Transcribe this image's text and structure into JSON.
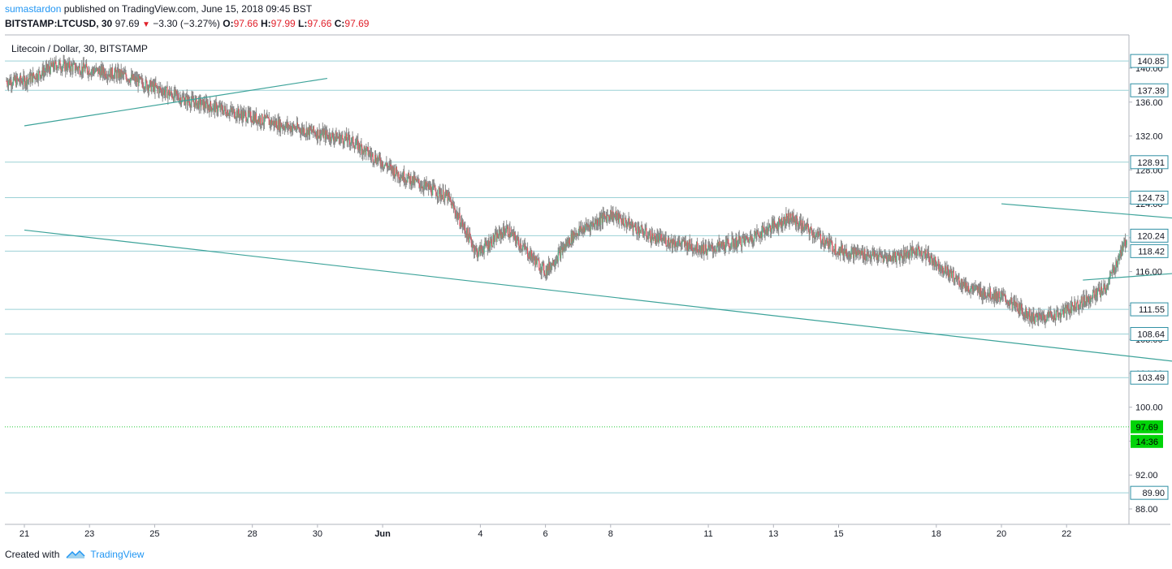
{
  "header": {
    "user": "sumastardon",
    "published": "published on TradingView.com, June 15, 2018 09:45 BST",
    "symbol": "BITSTAMP:LTCUSD, 30",
    "last": "97.69",
    "change_arrow": "▼",
    "change": "−3.30 (−3.27%)",
    "o_label": "O:",
    "o_value": "97.66",
    "h_label": "H:",
    "h_value": "97.99",
    "l_label": "L:",
    "l_value": "97.66",
    "c_label": "C:",
    "c_value": "97.69"
  },
  "footer": {
    "created_with": "Created with",
    "brand": "TradingView"
  },
  "colors": {
    "up": "#53b987",
    "down": "#eb4d5c",
    "line": "#3da39a",
    "hline": "#9bd1d6",
    "tag_bg": "#2e8fa3",
    "price_tag": "#00d408"
  },
  "chart_data": {
    "type": "candlestick",
    "title": "Litecoin / Dollar, 30, BITSTAMP",
    "xlabel": "",
    "ylabel": "",
    "ylim": [
      86.5,
      143.5
    ],
    "y_ticks": [
      "140.00",
      "136.00",
      "132.00",
      "128.00",
      "124.00",
      "120.00",
      "116.00",
      "112.00",
      "108.00",
      "104.00",
      "100.00",
      "96.00",
      "92.00",
      "88.00"
    ],
    "x_ticks": [
      "21",
      "23",
      "25",
      "28",
      "30",
      "Jun",
      "4",
      "6",
      "8",
      "11",
      "13",
      "15",
      "18",
      "20",
      "22"
    ],
    "levels": [
      "140.85",
      "137.39",
      "128.91",
      "124.73",
      "120.24",
      "118.42",
      "111.55",
      "108.64",
      "103.49",
      "89.90"
    ],
    "last_price": {
      "value": "97.69",
      "countdown": "14:36"
    },
    "path": [
      [
        0,
        138.5
      ],
      [
        1,
        140.4
      ],
      [
        3,
        139.2
      ],
      [
        5,
        136.2
      ],
      [
        8,
        133.2
      ],
      [
        10,
        131.5
      ],
      [
        11.5,
        127.5
      ],
      [
        13,
        124.8
      ],
      [
        13.9,
        118.2
      ],
      [
        14.8,
        121.0
      ],
      [
        16,
        116.0
      ],
      [
        16.9,
        120.5
      ],
      [
        18,
        122.8
      ],
      [
        19.3,
        120.0
      ],
      [
        21,
        118.6
      ],
      [
        22.2,
        119.8
      ],
      [
        23.5,
        122.4
      ],
      [
        25,
        118.5
      ],
      [
        26.5,
        117.6
      ],
      [
        27.5,
        118.5
      ],
      [
        29,
        114.0
      ],
      [
        30,
        113.0
      ],
      [
        31,
        110.5
      ],
      [
        31.8,
        111.0
      ],
      [
        33.2,
        114.0
      ],
      [
        34,
        121.2
      ],
      [
        35,
        122.5
      ],
      [
        36,
        121.0
      ],
      [
        37,
        119.5
      ],
      [
        38,
        116.0
      ],
      [
        39.5,
        118.5
      ],
      [
        40.5,
        120.5
      ],
      [
        41.5,
        118.5
      ],
      [
        43,
        117.3
      ],
      [
        44,
        118.3
      ],
      [
        45,
        119.0
      ],
      [
        46.5,
        119.8
      ],
      [
        47.4,
        123.5
      ],
      [
        48.5,
        122.5
      ],
      [
        50,
        123.0
      ],
      [
        51.3,
        123.0
      ],
      [
        51.8,
        127.4
      ],
      [
        52.5,
        127.2
      ],
      [
        53.2,
        126.4
      ],
      [
        54,
        126.0
      ],
      [
        55,
        123.5
      ],
      [
        56.5,
        120.0
      ],
      [
        57.5,
        119.5
      ],
      [
        58.5,
        117.0
      ],
      [
        59.5,
        116.4
      ],
      [
        60.5,
        121.8
      ],
      [
        61.5,
        122.8
      ],
      [
        63,
        122.2
      ],
      [
        64,
        122.6
      ],
      [
        64.8,
        120.0
      ],
      [
        65.5,
        123.5
      ],
      [
        66.5,
        122.5
      ],
      [
        68,
        122.0
      ],
      [
        70,
        121.0
      ],
      [
        71,
        120.0
      ],
      [
        72.2,
        120.4
      ],
      [
        73.5,
        120.8
      ],
      [
        75.5,
        118.8
      ],
      [
        76.3,
        115.7
      ],
      [
        77.6,
        113.0
      ],
      [
        78.4,
        106.8
      ],
      [
        79.5,
        108.0
      ],
      [
        80.5,
        106.0
      ],
      [
        81.5,
        107.0
      ],
      [
        83,
        107.5
      ],
      [
        84.5,
        106.5
      ],
      [
        85.2,
        102.5
      ],
      [
        86.1,
        98.5
      ],
      [
        87,
        99.0
      ],
      [
        87.7,
        98.4
      ],
      [
        88.4,
        95.0
      ],
      [
        89.2,
        90.0
      ],
      [
        90,
        92.5
      ],
      [
        91,
        94.8
      ],
      [
        92,
        96.0
      ],
      [
        92.7,
        96.6
      ],
      [
        93.5,
        97.6
      ],
      [
        94.1,
        102.0
      ],
      [
        95.2,
        100.5
      ],
      [
        95.7,
        97.7
      ]
    ],
    "trendlines": [
      [
        [
          0,
          133.2
        ],
        [
          9.3,
          138.8
        ]
      ],
      [
        [
          0,
          120.9
        ],
        [
          78.4,
          86.5
        ]
      ],
      [
        [
          30,
          124.0
        ],
        [
          55,
          116.0
        ]
      ],
      [
        [
          32.5,
          115.0
        ],
        [
          42.5,
          117.8
        ]
      ],
      [
        [
          45.7,
          127.8
        ],
        [
          54.8,
          116.3
        ]
      ],
      [
        [
          44.2,
          127.7
        ],
        [
          53.5,
          115.8
        ]
      ],
      [
        [
          57.3,
          124.5
        ],
        [
          65.3,
          117.2
        ]
      ],
      [
        [
          67.3,
          118.5
        ],
        [
          95.5,
          95.6
        ]
      ],
      [
        [
          70.9,
          103.6
        ],
        [
          75,
          109.0
        ]
      ],
      [
        [
          71.4,
          105.6
        ],
        [
          75.7,
          108.6
        ]
      ],
      [
        [
          79,
          89.4
        ],
        [
          84.5,
          96.2
        ]
      ],
      [
        [
          79,
          89.4
        ],
        [
          85.5,
          95.6
        ]
      ]
    ]
  }
}
